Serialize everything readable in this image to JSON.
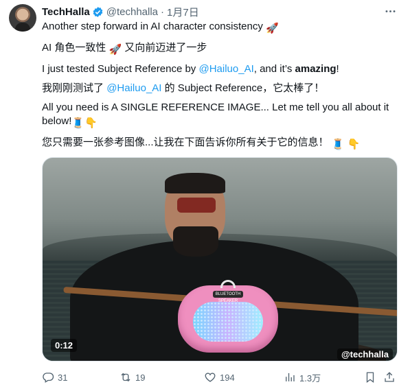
{
  "author": {
    "name": "TechHalla",
    "handle": "@techhalla",
    "separator": "·",
    "date": "1月7日",
    "verified_icon": "verified-badge-icon"
  },
  "more_icon": "more-horizontal-icon",
  "tweet": {
    "line1": "Another step forward in AI character consistency",
    "line2_prefix": "AI 角色一致性",
    "line2_suffix": "又向前迈进了一步",
    "line3_prefix": "I just tested Subject Reference by",
    "line3_link": "@Hailuo_AI",
    "line3_middle": ", and it’s",
    "line3_bold": "amazing",
    "line3_end": "!",
    "line4_prefix": "我刚刚测试了",
    "line4_link": "@Hailuo_AI",
    "line4_suffix": "的 Subject Reference，它太棒了！",
    "line5": "All you need is A SINGLE REFERENCE IMAGE... Let me tell you all about it below!",
    "line6": "您只需要一张参考图像...让我在下面告诉你所有关于它的信息！",
    "emojis": {
      "rocket": "🚀",
      "thread": "🧵",
      "point_down": "👇"
    }
  },
  "media": {
    "duration": "0:12",
    "watermark": "@techhalla",
    "speaker_brand": "BLUETOOTH SPEAKER"
  },
  "actions": {
    "reply": {
      "icon": "reply-icon",
      "count": "31"
    },
    "retweet": {
      "icon": "retweet-icon",
      "count": "19"
    },
    "like": {
      "icon": "heart-icon",
      "count": "194"
    },
    "views": {
      "icon": "views-chart-icon",
      "count": "1.3万"
    },
    "bookmark": {
      "icon": "bookmark-icon"
    },
    "share": {
      "icon": "share-icon"
    }
  },
  "colors": {
    "link": "#1d9bf0",
    "secondary_text": "#536471",
    "verified": "#1d9bf0"
  }
}
